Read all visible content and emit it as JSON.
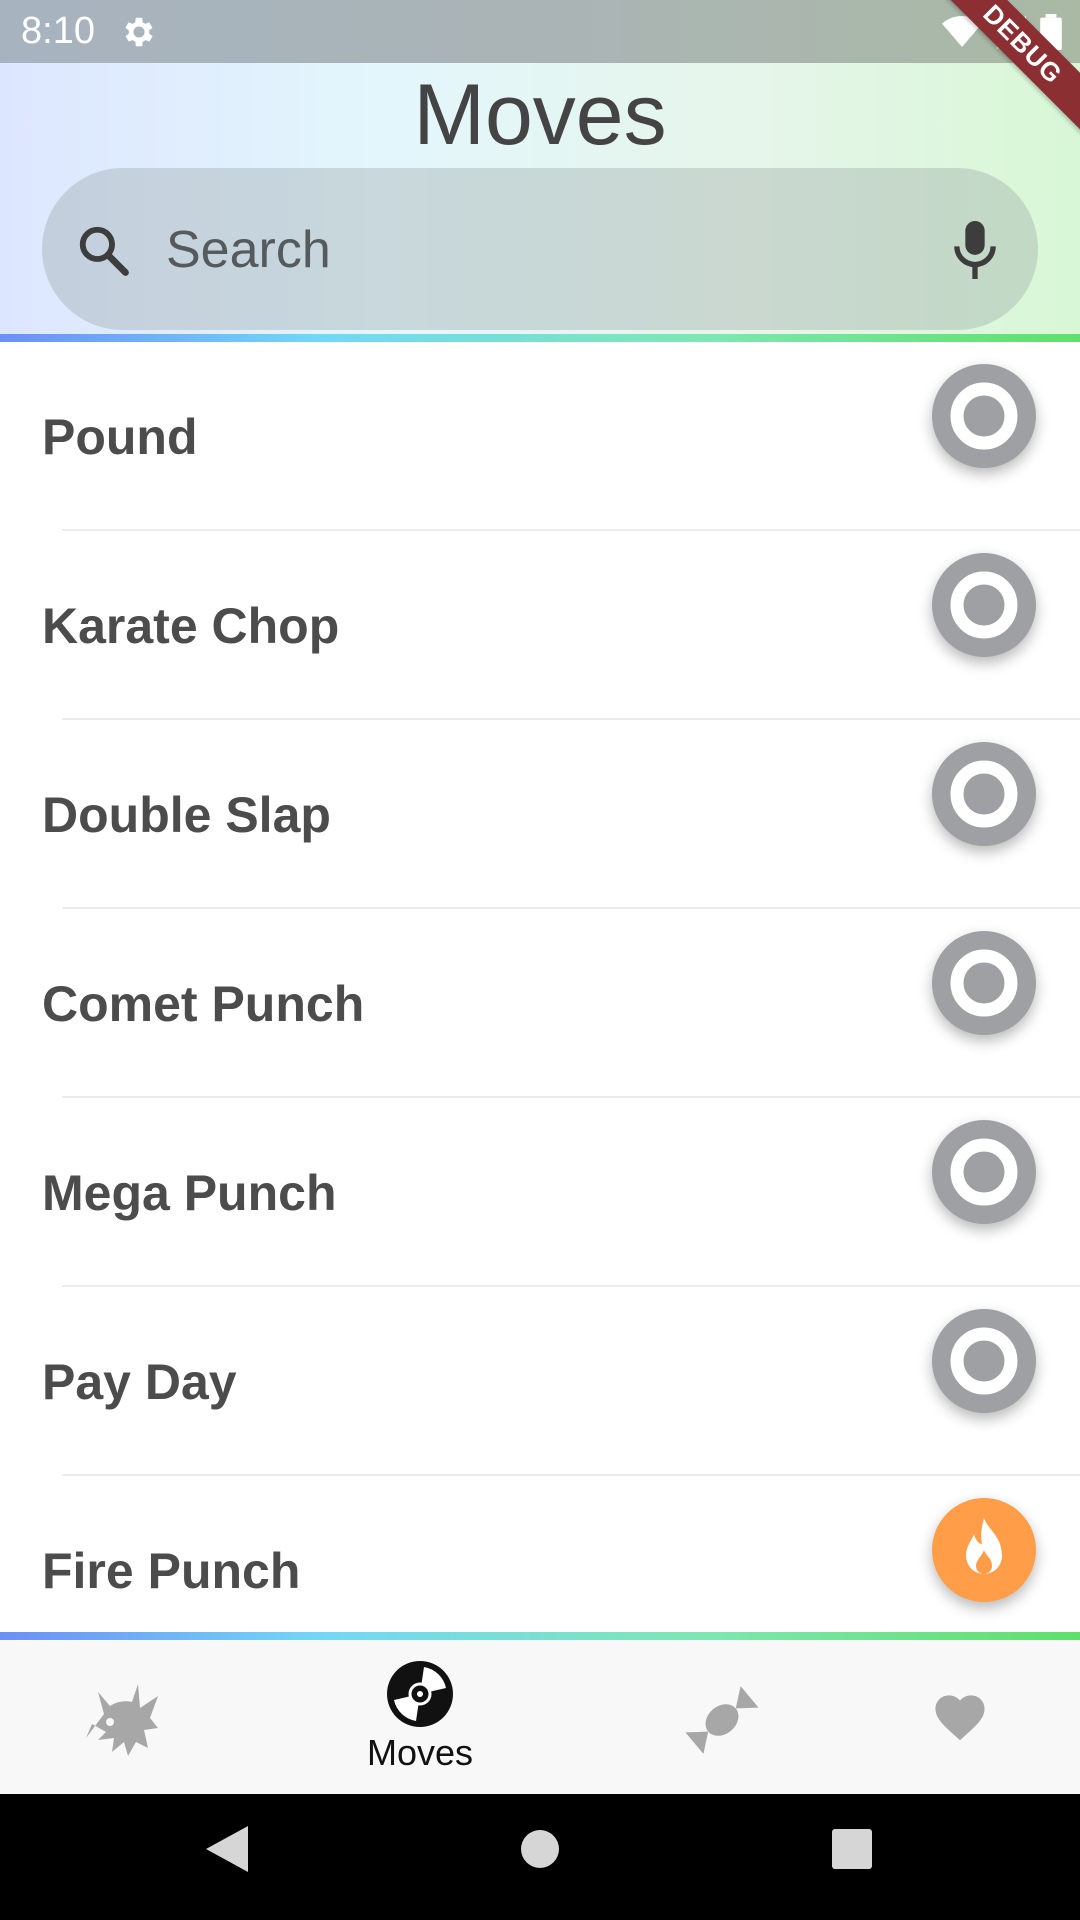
{
  "status_bar": {
    "time": "8:10",
    "icons": [
      "gear-icon",
      "wifi-icon",
      "signal-icon",
      "battery-icon"
    ]
  },
  "debug_banner": "DEBUG",
  "header": {
    "title": "Moves"
  },
  "search": {
    "placeholder": "Search",
    "value": ""
  },
  "moves": [
    {
      "name": "Pound",
      "type_icon": "normal-type-icon",
      "color": "#9ea0a3"
    },
    {
      "name": "Karate Chop",
      "type_icon": "normal-type-icon",
      "color": "#9ea0a3"
    },
    {
      "name": "Double Slap",
      "type_icon": "normal-type-icon",
      "color": "#9ea0a3"
    },
    {
      "name": "Comet Punch",
      "type_icon": "normal-type-icon",
      "color": "#9ea0a3"
    },
    {
      "name": "Mega Punch",
      "type_icon": "normal-type-icon",
      "color": "#9ea0a3"
    },
    {
      "name": "Pay Day",
      "type_icon": "normal-type-icon",
      "color": "#9ea0a3"
    },
    {
      "name": "Fire Punch",
      "type_icon": "fire-type-icon",
      "color": "#ff9d48"
    }
  ],
  "bottom_nav": {
    "selected": "Moves",
    "items": [
      {
        "icon": "pikachu-icon",
        "label": ""
      },
      {
        "icon": "disc-icon",
        "label": "Moves"
      },
      {
        "icon": "candy-icon",
        "label": ""
      },
      {
        "icon": "heart-icon",
        "label": ""
      }
    ]
  },
  "colors": {
    "accent_line_start": "#6d8ff5",
    "accent_line_end": "#5fe06a",
    "normal_type": "#9ea0a3",
    "fire_type": "#ff9d48",
    "text": "#4c4c4c"
  }
}
